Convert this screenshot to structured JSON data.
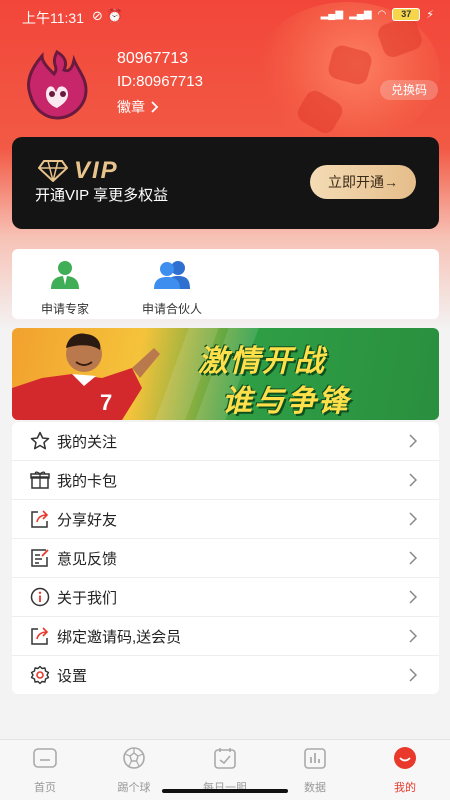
{
  "status_bar": {
    "time": "上午11:31",
    "battery": "37"
  },
  "profile": {
    "name": "80967713",
    "id_text": "ID:80967713",
    "badge_label": "徽章",
    "redeem_label": "兑换码"
  },
  "vip": {
    "logo_text": "VIP",
    "subtitle": "开通VIP 享更多权益",
    "button_label": "立即开通→"
  },
  "apply": {
    "items": [
      {
        "label": "申请专家",
        "icon": "expert-person-icon",
        "color": "#3fae56"
      },
      {
        "label": "申请合伙人",
        "icon": "partner-people-icon",
        "color": "#3e8ef0"
      }
    ]
  },
  "banner": {
    "line1": "激情开战",
    "line2": "谁与争锋",
    "player_number": "7"
  },
  "menu": {
    "items": [
      {
        "label": "我的关注",
        "icon": "star-icon"
      },
      {
        "label": "我的卡包",
        "icon": "gift-icon"
      },
      {
        "label": "分享好友",
        "icon": "share-icon"
      },
      {
        "label": "意见反馈",
        "icon": "feedback-icon"
      },
      {
        "label": "关于我们",
        "icon": "info-icon"
      },
      {
        "label": "绑定邀请码,送会员",
        "icon": "invite-share-icon"
      },
      {
        "label": "设置",
        "icon": "gear-icon"
      }
    ]
  },
  "tabs": {
    "items": [
      {
        "label": "首页",
        "icon": "home-icon"
      },
      {
        "label": "踢个球",
        "icon": "soccer-ball-icon"
      },
      {
        "label": "每日一胆",
        "icon": "calendar-check-icon"
      },
      {
        "label": "数据",
        "icon": "bar-chart-icon"
      },
      {
        "label": "我的",
        "icon": "profile-smile-icon",
        "active": true
      }
    ]
  },
  "colors": {
    "accent": "#e8392c",
    "vip_gold": "#e8c48c",
    "hero_red": "#f2463a"
  }
}
